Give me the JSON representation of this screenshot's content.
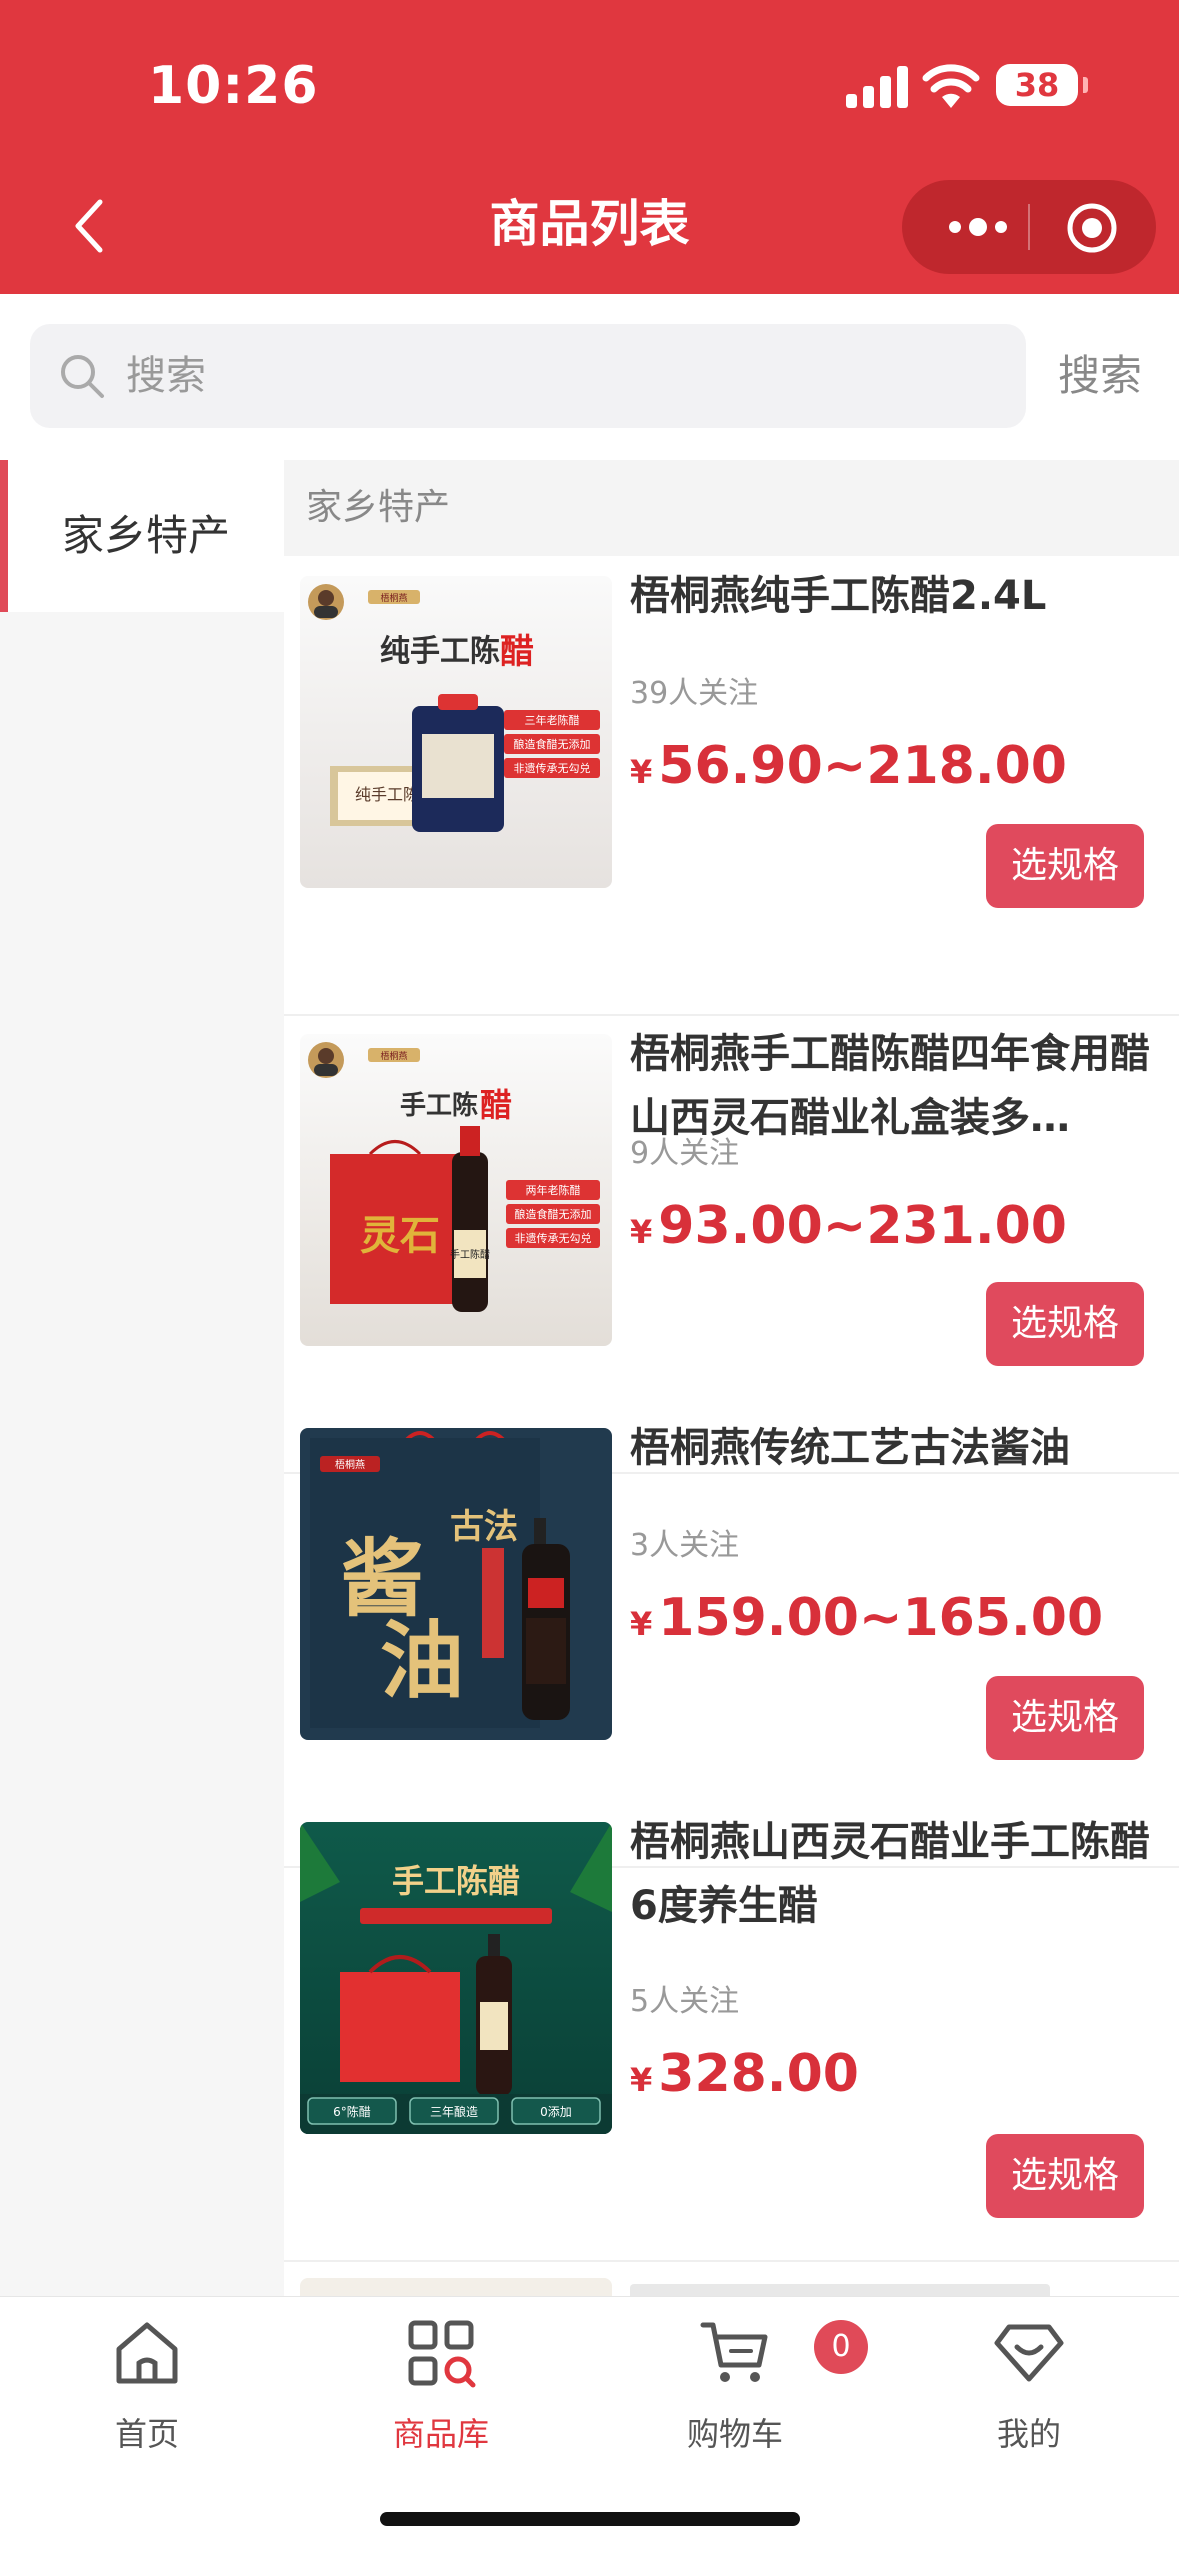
{
  "status_bar": {
    "time": "10:26",
    "battery": "38"
  },
  "nav": {
    "title": "商品列表"
  },
  "search": {
    "placeholder": "搜索",
    "button": "搜索"
  },
  "sidebar": {
    "items": [
      {
        "label": "家乡特产"
      }
    ]
  },
  "category": {
    "title": "家乡特产"
  },
  "products": [
    {
      "name": "梧桐燕纯手工陈醋2.4L",
      "followers": "39人关注",
      "currency": "¥",
      "price": "56.90~218.00",
      "button": "选规格"
    },
    {
      "name": "梧桐燕手工醋陈醋四年食用醋山西灵石醋业礼盒装多…",
      "followers": "9人关注",
      "currency": "¥",
      "price": "93.00~231.00",
      "button": "选规格"
    },
    {
      "name": "梧桐燕传统工艺古法酱油",
      "followers": "3人关注",
      "currency": "¥",
      "price": "159.00~165.00",
      "button": "选规格"
    },
    {
      "name": "梧桐燕山西灵石醋业手工陈醋6度养生醋",
      "followers": "5人关注",
      "currency": "¥",
      "price": "328.00",
      "button": "选规格"
    }
  ],
  "tabbar": {
    "items": [
      {
        "label": "首页",
        "icon": "home-icon"
      },
      {
        "label": "商品库",
        "icon": "product-library-icon"
      },
      {
        "label": "购物车",
        "icon": "cart-icon"
      },
      {
        "label": "我的",
        "icon": "profile-icon"
      }
    ],
    "cart_badge": "0",
    "active": 1
  },
  "colors": {
    "brand": "#e0373f",
    "price": "#d8303a",
    "button": "#e04a5d"
  },
  "thumb_text": {
    "p1": {
      "brand": "梧桐燕",
      "headline": "纯手工陈",
      "headline_accent": "醋",
      "tags": [
        "三年老陈醋",
        "酿造食醋无添加",
        "非遗传承无勾兑"
      ],
      "label": "纯手工陈醋"
    },
    "p2": {
      "brand": "梧桐燕",
      "headline": "手工陈",
      "headline_accent": "醋",
      "tags": [
        "两年老陈醋",
        "酿造食醋无添加",
        "非遗传承无勾兑"
      ],
      "bottle": "手工陈醋",
      "bag": "灵石"
    },
    "p3": {
      "brand": "梧桐燕",
      "big1": "酱",
      "big2": "油",
      "small": "古法"
    },
    "p4": {
      "headline": "手工陈醋",
      "tags": [
        "6°陈醋",
        "三年酿造",
        "0添加"
      ]
    }
  }
}
